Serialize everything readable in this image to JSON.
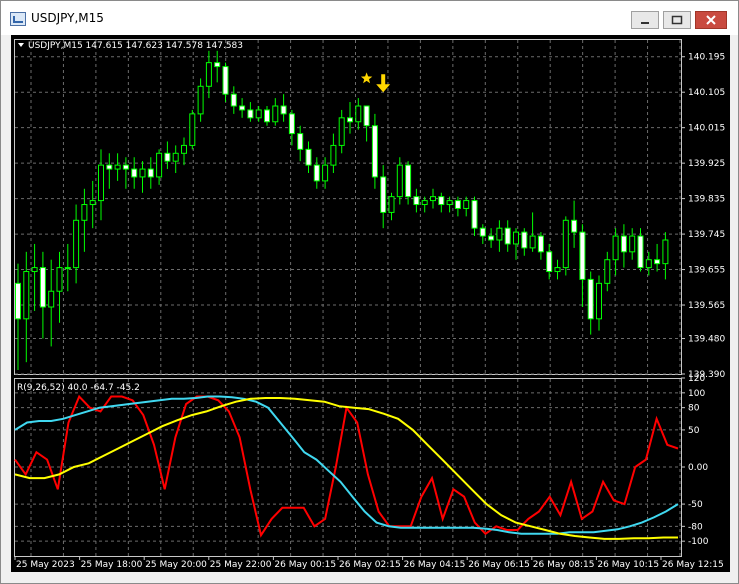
{
  "window": {
    "title": "USDJPY,M15",
    "minimize_icon": "minimize-icon",
    "maximize_icon": "maximize-icon",
    "close_icon": "close-icon"
  },
  "chart_data": [
    {
      "type": "candlestick",
      "header": "USDJPY,M15  147.615 147.623 147.578 147.583",
      "ylim": [
        139.39,
        140.24
      ],
      "y_ticks": [
        "140.195",
        "140.105",
        "140.015",
        "139.925",
        "139.835",
        "139.745",
        "139.655",
        "139.565",
        "139.480",
        "139.390"
      ],
      "x_ticks": [
        "25 May 2023",
        "25 May 18:00",
        "25 May 20:00",
        "25 May 22:00",
        "26 May 00:15",
        "26 May 02:15",
        "26 May 04:15",
        "26 May 06:15",
        "26 May 08:15",
        "26 May 10:15",
        "26 May 12:15"
      ],
      "colors": {
        "bull": "#000000",
        "bear": "#ffffff",
        "wick": "#00ff00",
        "grid": "#6c6c6c",
        "marker": "#ffd700"
      },
      "candles": [
        [
          139.62,
          139.67,
          139.4,
          139.53
        ],
        [
          139.53,
          139.7,
          139.42,
          139.65
        ],
        [
          139.65,
          139.72,
          139.55,
          139.66
        ],
        [
          139.66,
          139.7,
          139.48,
          139.56
        ],
        [
          139.56,
          139.68,
          139.46,
          139.6
        ],
        [
          139.6,
          139.7,
          139.52,
          139.66
        ],
        [
          139.66,
          139.72,
          139.6,
          139.66
        ],
        [
          139.66,
          139.82,
          139.62,
          139.78
        ],
        [
          139.78,
          139.86,
          139.7,
          139.82
        ],
        [
          139.82,
          139.88,
          139.76,
          139.83
        ],
        [
          139.83,
          139.96,
          139.78,
          139.92
        ],
        [
          139.92,
          139.95,
          139.86,
          139.91
        ],
        [
          139.91,
          139.95,
          139.88,
          139.92
        ],
        [
          139.92,
          139.94,
          139.86,
          139.91
        ],
        [
          139.91,
          139.94,
          139.86,
          139.89
        ],
        [
          139.89,
          139.93,
          139.85,
          139.91
        ],
        [
          139.91,
          139.94,
          139.86,
          139.89
        ],
        [
          139.89,
          139.96,
          139.87,
          139.95
        ],
        [
          139.95,
          139.98,
          139.91,
          139.93
        ],
        [
          139.93,
          139.97,
          139.9,
          139.95
        ],
        [
          139.95,
          139.99,
          139.92,
          139.97
        ],
        [
          139.97,
          140.06,
          139.96,
          140.05
        ],
        [
          140.05,
          140.14,
          140.03,
          140.12
        ],
        [
          140.12,
          140.21,
          140.09,
          140.18
        ],
        [
          140.18,
          140.21,
          140.13,
          140.17
        ],
        [
          140.17,
          140.18,
          140.08,
          140.1
        ],
        [
          140.1,
          140.12,
          140.05,
          140.07
        ],
        [
          140.07,
          140.09,
          140.04,
          140.06
        ],
        [
          140.06,
          140.08,
          140.03,
          140.04
        ],
        [
          140.04,
          140.07,
          140.03,
          140.06
        ],
        [
          140.06,
          140.07,
          140.02,
          140.03
        ],
        [
          140.03,
          140.09,
          140.02,
          140.07
        ],
        [
          140.07,
          140.1,
          140.03,
          140.05
        ],
        [
          140.05,
          140.06,
          139.97,
          140.0
        ],
        [
          140.0,
          140.02,
          139.93,
          139.96
        ],
        [
          139.96,
          139.98,
          139.9,
          139.92
        ],
        [
          139.92,
          139.94,
          139.86,
          139.88
        ],
        [
          139.88,
          139.94,
          139.86,
          139.92
        ],
        [
          139.92,
          140.0,
          139.9,
          139.97
        ],
        [
          139.97,
          140.06,
          139.95,
          140.04
        ],
        [
          140.04,
          140.08,
          140.0,
          140.03
        ],
        [
          140.03,
          140.09,
          140.01,
          140.07
        ],
        [
          140.07,
          140.07,
          139.98,
          140.02
        ],
        [
          140.02,
          140.05,
          139.86,
          139.89
        ],
        [
          139.89,
          139.92,
          139.76,
          139.8
        ],
        [
          139.8,
          139.85,
          139.78,
          139.84
        ],
        [
          139.84,
          139.94,
          139.82,
          139.92
        ],
        [
          139.92,
          139.93,
          139.82,
          139.84
        ],
        [
          139.84,
          139.86,
          139.8,
          139.82
        ],
        [
          139.82,
          139.84,
          139.8,
          139.83
        ],
        [
          139.83,
          139.86,
          139.81,
          139.84
        ],
        [
          139.84,
          139.85,
          139.8,
          139.82
        ],
        [
          139.82,
          139.84,
          139.8,
          139.83
        ],
        [
          139.83,
          139.84,
          139.79,
          139.81
        ],
        [
          139.81,
          139.84,
          139.79,
          139.83
        ],
        [
          139.83,
          139.84,
          139.74,
          139.76
        ],
        [
          139.76,
          139.77,
          139.72,
          139.74
        ],
        [
          139.74,
          139.76,
          139.71,
          139.73
        ],
        [
          139.73,
          139.78,
          139.7,
          139.76
        ],
        [
          139.76,
          139.78,
          139.7,
          139.72
        ],
        [
          139.72,
          139.76,
          139.68,
          139.75
        ],
        [
          139.75,
          139.76,
          139.69,
          139.71
        ],
        [
          139.71,
          139.8,
          139.7,
          139.74
        ],
        [
          139.74,
          139.75,
          139.68,
          139.7
        ],
        [
          139.7,
          139.72,
          139.63,
          139.65
        ],
        [
          139.65,
          139.68,
          139.63,
          139.66
        ],
        [
          139.66,
          139.79,
          139.64,
          139.78
        ],
        [
          139.78,
          139.83,
          139.71,
          139.75
        ],
        [
          139.75,
          139.77,
          139.56,
          139.63
        ],
        [
          139.63,
          139.65,
          139.49,
          139.53
        ],
        [
          139.53,
          139.64,
          139.5,
          139.62
        ],
        [
          139.62,
          139.7,
          139.6,
          139.68
        ],
        [
          139.68,
          139.76,
          139.64,
          139.74
        ],
        [
          139.74,
          139.77,
          139.66,
          139.7
        ],
        [
          139.7,
          139.76,
          139.68,
          139.74
        ],
        [
          139.74,
          139.76,
          139.65,
          139.66
        ],
        [
          139.66,
          139.7,
          139.64,
          139.68
        ],
        [
          139.68,
          139.72,
          139.65,
          139.67
        ],
        [
          139.67,
          139.75,
          139.63,
          139.73
        ]
      ],
      "annotations": [
        {
          "type": "star",
          "candle": 42,
          "price": 140.14
        },
        {
          "type": "down-arrow",
          "candle": 44,
          "price": 140.12
        }
      ]
    },
    {
      "type": "line",
      "title": "R(9,26,52) 40.0 -64.7 -45.2",
      "ylim": [
        -120,
        120
      ],
      "y_ticks": [
        {
          "v": 120,
          "t": "120"
        },
        {
          "v": 100,
          "t": "100"
        },
        {
          "v": 80,
          "t": "80"
        },
        {
          "v": 50,
          "t": "50"
        },
        {
          "v": 0,
          "t": "0.00"
        },
        {
          "v": -50,
          "t": "-50"
        },
        {
          "v": -80,
          "t": "-80"
        },
        {
          "v": -100,
          "t": "-100"
        }
      ],
      "series": [
        {
          "color": "#ff0000",
          "values": [
            10,
            -10,
            20,
            10,
            -30,
            60,
            95,
            80,
            75,
            95,
            95,
            90,
            70,
            30,
            -30,
            40,
            85,
            95,
            95,
            90,
            75,
            40,
            -30,
            -92,
            -70,
            -55,
            -55,
            -55,
            -80,
            -70,
            0,
            80,
            60,
            -10,
            -60,
            -80,
            -80,
            -80,
            -40,
            -15,
            -70,
            -30,
            -40,
            -75,
            -90,
            -80,
            -85,
            -85,
            -70,
            -60,
            -40,
            -65,
            -20,
            -70,
            -60,
            -20,
            -45,
            -50,
            0,
            10,
            65,
            30,
            25
          ]
        },
        {
          "color": "#40d8f0",
          "values": [
            50,
            60,
            62,
            62,
            65,
            70,
            75,
            80,
            82,
            84,
            86,
            88,
            90,
            92,
            92,
            93,
            95,
            95,
            94,
            92,
            88,
            80,
            60,
            40,
            20,
            10,
            -5,
            -20,
            -40,
            -60,
            -75,
            -80,
            -82,
            -82,
            -82,
            -82,
            -82,
            -82,
            -82,
            -83,
            -85,
            -88,
            -90,
            -90,
            -90,
            -90,
            -88,
            -88,
            -88,
            -86,
            -84,
            -80,
            -75,
            -68,
            -60,
            -50
          ]
        },
        {
          "color": "#ffff00",
          "values": [
            -10,
            -15,
            -15,
            -10,
            0,
            5,
            15,
            25,
            35,
            45,
            55,
            63,
            70,
            75,
            82,
            88,
            92,
            93,
            93,
            92,
            90,
            88,
            82,
            80,
            78,
            72,
            65,
            50,
            30,
            10,
            -10,
            -30,
            -50,
            -65,
            -75,
            -80,
            -85,
            -90,
            -93,
            -95,
            -97,
            -97,
            -96,
            -96,
            -95,
            -95
          ]
        }
      ]
    }
  ]
}
